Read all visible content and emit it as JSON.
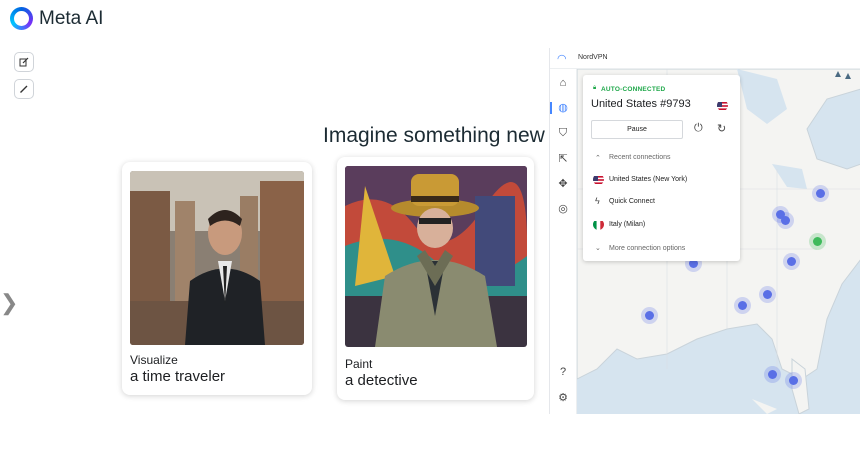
{
  "app": {
    "name": "Meta AI"
  },
  "sidebar": {
    "new_chat_icon": "edit-icon",
    "pen_icon": "pencil-icon",
    "expand_icon": "chevron-right-icon"
  },
  "main": {
    "headline": "Imagine something new",
    "cards": [
      {
        "subtitle": "Visualize",
        "title": "a time traveler"
      },
      {
        "subtitle": "Paint",
        "title": "a detective"
      }
    ]
  },
  "nordvpn": {
    "window_title": "NordVPN",
    "status": "AUTO-CONNECTED",
    "server": "United States #9793",
    "pause_label": "Pause",
    "recent_label": "Recent connections",
    "recent": [
      {
        "label": "United States (New York)",
        "flag": "us-flag-icon"
      },
      {
        "label": "Quick Connect",
        "icon": "lightning-icon"
      },
      {
        "label": "Italy (Milan)",
        "flag": "italy-flag-icon"
      }
    ],
    "more_label": "More connection options",
    "colors": {
      "accent": "#4687ff",
      "connected": "#1fa84a",
      "map_water": "#d6e4ef",
      "pin": "#5a6fe6"
    }
  }
}
